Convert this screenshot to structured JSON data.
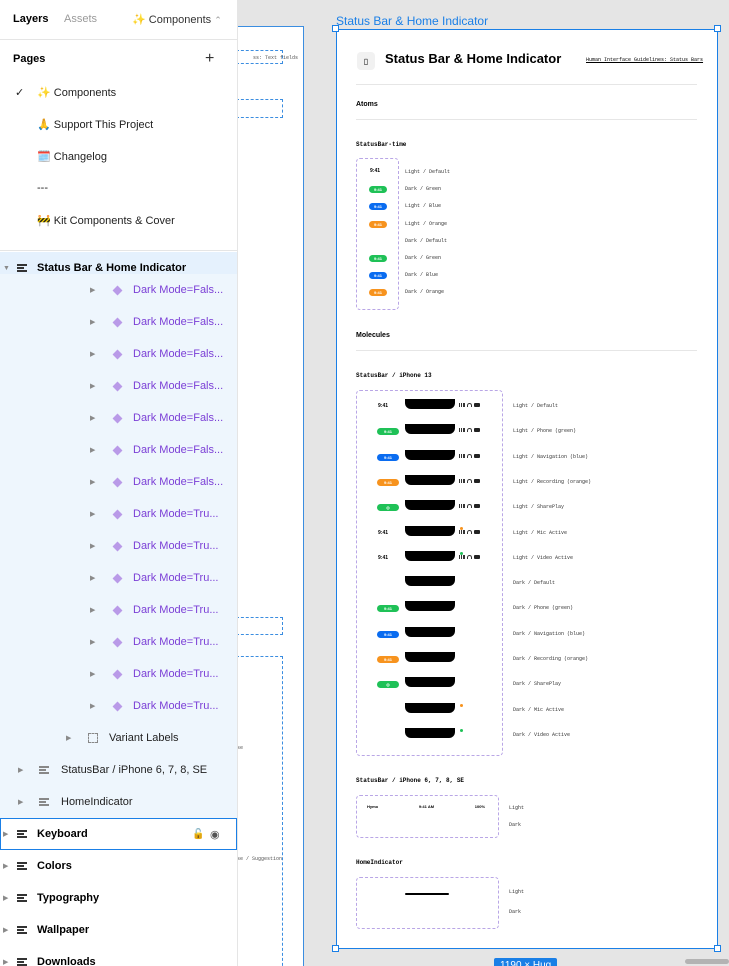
{
  "sidebar": {
    "tabs": {
      "layers": "Layers",
      "assets": "Assets"
    },
    "page_selector": "✨ Components",
    "pages_heading": "Pages",
    "add_page_icon": "plus-icon",
    "pages": [
      {
        "label": "✨ Components",
        "selected": true
      },
      {
        "label": "🙏 Support This Project",
        "selected": false
      },
      {
        "label": "🗓️ Changelog",
        "selected": false
      },
      {
        "label": "---",
        "selected": false
      },
      {
        "label": "🚧 Kit Components & Cover",
        "selected": false
      }
    ],
    "layers": {
      "top": "Status Bar & Home Indicator",
      "variants": [
        "Dark Mode=False, ...",
        "Dark Mode=False, ...",
        "Dark Mode=False, ...",
        "Dark Mode=False, ...",
        "Dark Mode=False, ...",
        "Dark Mode=False, ...",
        "Dark Mode=False, ...",
        "Dark Mode=True, ...",
        "Dark Mode=True, ...",
        "Dark Mode=True, ...",
        "Dark Mode=True, ...",
        "Dark Mode=True, ...",
        "Dark Mode=True, ...",
        "Dark Mode=True, ..."
      ],
      "variant_display": [
        "Dark Mode=Fals...",
        "Dark Mode=Fals...",
        "Dark Mode=Fals...",
        "Dark Mode=Fals...",
        "Dark Mode=Fals...",
        "Dark Mode=Fals...",
        "Dark Mode=Fals...",
        "Dark Mode=Tru...",
        "Dark Mode=Tru...",
        "Dark Mode=Tru...",
        "Dark Mode=Tru...",
        "Dark Mode=Tru...",
        "Dark Mode=Tru...",
        "Dark Mode=Tru..."
      ],
      "variant_labels": "Variant Labels",
      "statusbar_old": "StatusBar / iPhone 6, 7, 8, SE",
      "home_indicator": "HomeIndicator",
      "others": [
        "Keyboard",
        "Colors",
        "Typography",
        "Wallpaper",
        "Downloads"
      ]
    }
  },
  "canvas": {
    "frame_label": "Status Bar & Home Indicator",
    "size_badge": "1190 × Hug",
    "ghost_texts": [
      "ss: Text fields",
      "se",
      "se / Suggestion"
    ],
    "frame": {
      "title": "Status Bar & Home Indicator",
      "link": "Human Interface Guidelines: Status Bars",
      "atoms": "Atoms",
      "statusbar_time": "StatusBar-time",
      "time": "9:41",
      "time_labels": [
        "Light / Default",
        "Dark / Green",
        "Light / Blue",
        "Light / Orange",
        "Dark / Default",
        "Dark / Green",
        "Dark / Blue",
        "Dark / Orange"
      ],
      "molecules": "Molecules",
      "iphone13": "StatusBar / iPhone 13",
      "iphone13_labels": [
        "Light / Default",
        "Light / Phone (green)",
        "Light / Navigation (blue)",
        "Light / Recording (orange)",
        "Light / SharePlay",
        "Light / Mic Active",
        "Light / Video Active",
        "Dark / Default",
        "Dark / Phone (green)",
        "Dark / Navigation (blue)",
        "Dark / Recording (orange)",
        "Dark / SharePlay",
        "Dark / Mic Active",
        "Dark / Video Active"
      ],
      "iphone678": "StatusBar / iPhone 6, 7, 8, SE",
      "old_bar": {
        "carrier": "Hymo",
        "time": "9:41 AM",
        "battery": "100%"
      },
      "old_labels": [
        "Light",
        "Dark"
      ],
      "home_indicator": "HomeIndicator",
      "home_labels": [
        "Light",
        "Dark"
      ]
    }
  },
  "colors": {
    "accent": "#1a7fe6",
    "green": "#1fc157",
    "blue": "#0a6cf0",
    "orange": "#f7931e",
    "component_purple": "#7b3fd6"
  }
}
